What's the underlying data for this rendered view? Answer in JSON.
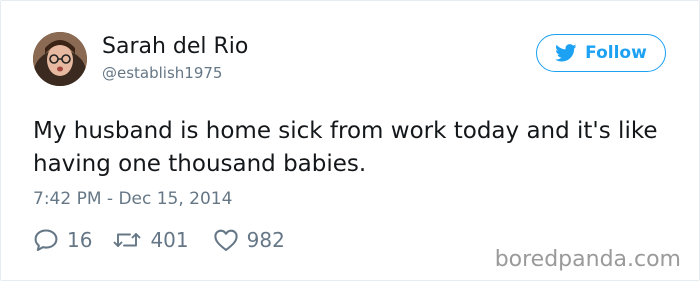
{
  "author": {
    "name": "Sarah del Rio",
    "handle": "@establish1975"
  },
  "follow_button": {
    "label": "Follow",
    "icon": "twitter-bird-icon",
    "color": "#1da1f2"
  },
  "tweet": {
    "text": "My husband is home sick from work today and it's like having one thousand babies.",
    "timestamp": "7:42 PM - Dec 15, 2014"
  },
  "actions": {
    "replies": "16",
    "retweets": "401",
    "likes": "982"
  },
  "watermark": "boredpanda.com"
}
